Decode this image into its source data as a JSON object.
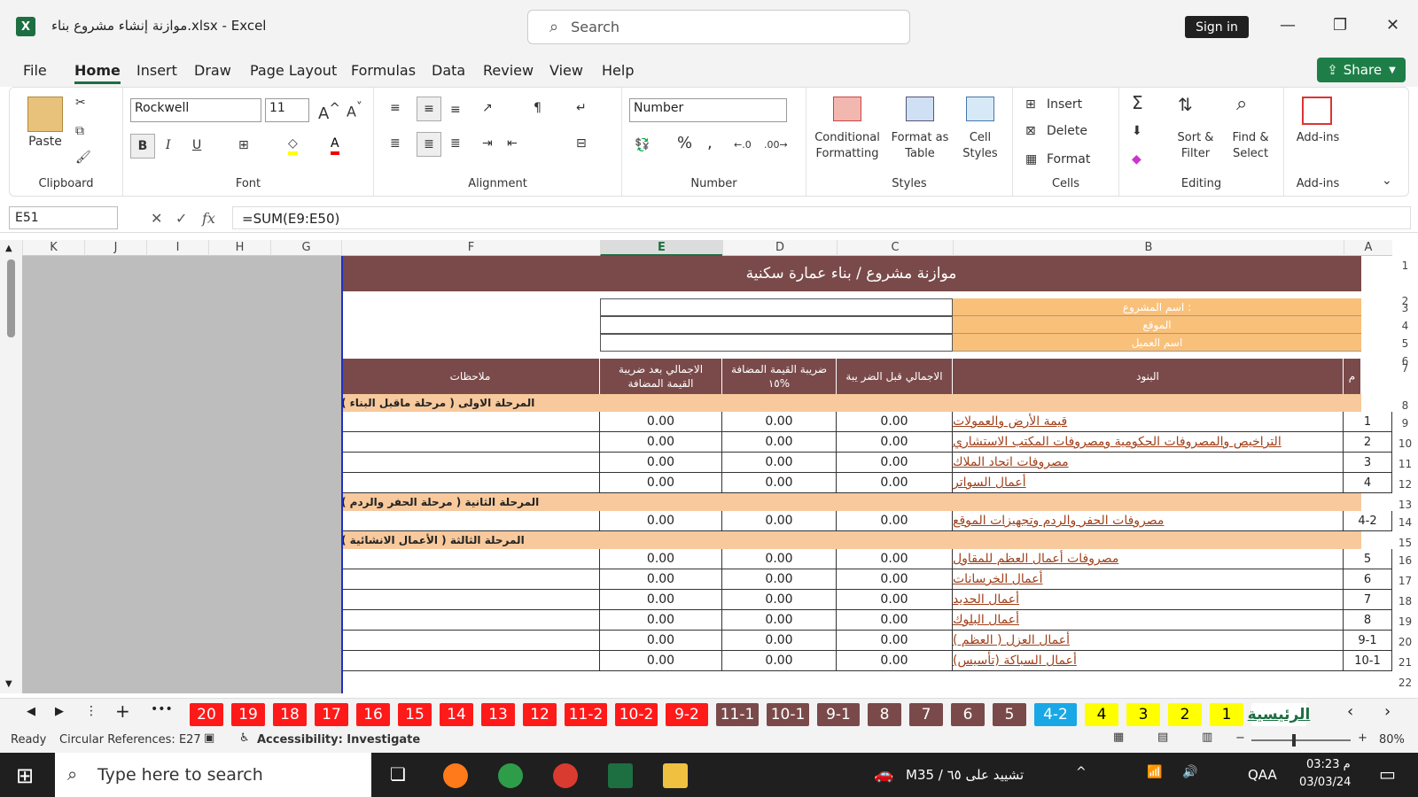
{
  "window": {
    "title": "موازنة إنشاء مشروع بناء.xlsx  -  Excel",
    "search_placeholder": "Search",
    "sign_in": "Sign in"
  },
  "menu": {
    "tabs": [
      "File",
      "Home",
      "Insert",
      "Draw",
      "Page Layout",
      "Formulas",
      "Data",
      "Review",
      "View",
      "Help"
    ],
    "active": "Home",
    "share": "Share"
  },
  "ribbon": {
    "clipboard": {
      "label": "Clipboard",
      "paste": "Paste"
    },
    "font": {
      "label": "Font",
      "family": "Rockwell",
      "size": "11"
    },
    "alignment": {
      "label": "Alignment"
    },
    "number": {
      "label": "Number",
      "format": "Number"
    },
    "styles": {
      "label": "Styles",
      "conditional": "Conditional Formatting",
      "format_table": "Format as Table",
      "cell_styles": "Cell Styles"
    },
    "cells": {
      "label": "Cells",
      "insert": "Insert",
      "delete": "Delete",
      "format": "Format"
    },
    "editing": {
      "label": "Editing",
      "sort": "Sort & Filter",
      "find": "Find & Select"
    },
    "addins": {
      "label": "Add-ins",
      "addins": "Add-ins"
    }
  },
  "formula_bar": {
    "name_box": "E51",
    "formula": "=SUM(E9:E50)"
  },
  "columns": [
    "K",
    "J",
    "I",
    "H",
    "G",
    "F",
    "E",
    "D",
    "C",
    "B",
    "A"
  ],
  "selected_column": "E",
  "row_numbers": [
    "1",
    "2",
    "3",
    "4",
    "5",
    "6",
    "7",
    "8",
    "9",
    "10",
    "11",
    "12",
    "13",
    "14",
    "15",
    "16",
    "17",
    "18",
    "19",
    "20",
    "21",
    "22"
  ],
  "sheet": {
    "title": "موازنة مشروع / بناء عمارة سكنية",
    "info_labels": [
      "اسم المشروع :",
      "الموقع",
      "اسم العميل"
    ],
    "headers": {
      "num": "م",
      "item": "البنود",
      "before_tax": "الاجمالي قبل الضر يبة",
      "vat": "ضريبة القيمة المضافة ١٥%",
      "after_tax": "الاجمالي بعد ضريبة القيمة المضافة",
      "notes": "ملاحظات"
    },
    "rows": [
      {
        "type": "section",
        "label": "المرحلة الاولى ( مرحلة ماقبل البناء )"
      },
      {
        "type": "item",
        "num": "1",
        "item": "قيمة الأرض والعمولات",
        "c": "0.00",
        "d": "0.00",
        "e": "0.00"
      },
      {
        "type": "item",
        "num": "2",
        "item": "التراخيص والمصروفات الحكومية ومصروفات المكتب الاستشاري",
        "c": "0.00",
        "d": "0.00",
        "e": "0.00"
      },
      {
        "type": "item",
        "num": "3",
        "item": "مصروفات اتحاد الملاك",
        "c": "0.00",
        "d": "0.00",
        "e": "0.00"
      },
      {
        "type": "item",
        "num": "4",
        "item": "أعمال السواتر",
        "c": "0.00",
        "d": "0.00",
        "e": "0.00"
      },
      {
        "type": "section",
        "label": "المرحلة الثانية ( مرحلة الحفر والردم )"
      },
      {
        "type": "item",
        "num": "4-2",
        "item": "مصروفات الحفر والردم وتجهيزات الموقع",
        "c": "0.00",
        "d": "0.00",
        "e": "0.00"
      },
      {
        "type": "section",
        "label": "المرحلة الثالثة ( الأعمال الانشائية )"
      },
      {
        "type": "item",
        "num": "5",
        "item": "مصروفات أعمال العظم للمقاول",
        "c": "0.00",
        "d": "0.00",
        "e": "0.00"
      },
      {
        "type": "item",
        "num": "6",
        "item": "أعمال الخرسانات",
        "c": "0.00",
        "d": "0.00",
        "e": "0.00"
      },
      {
        "type": "item",
        "num": "7",
        "item": "أعمال الحديد",
        "c": "0.00",
        "d": "0.00",
        "e": "0.00"
      },
      {
        "type": "item",
        "num": "8",
        "item": "أعمال البلوك",
        "c": "0.00",
        "d": "0.00",
        "e": "0.00"
      },
      {
        "type": "item",
        "num": "9-1",
        "item": "أعمال العزل ( العظم )",
        "c": "0.00",
        "d": "0.00",
        "e": "0.00"
      },
      {
        "type": "item",
        "num": "10-1",
        "item": "أعمال السباكة (تأسيس)",
        "c": "0.00",
        "d": "0.00",
        "e": "0.00"
      }
    ]
  },
  "sheet_tabs": [
    {
      "label": "20",
      "color": "red"
    },
    {
      "label": "19",
      "color": "red"
    },
    {
      "label": "18",
      "color": "red"
    },
    {
      "label": "17",
      "color": "red"
    },
    {
      "label": "16",
      "color": "red"
    },
    {
      "label": "15",
      "color": "red"
    },
    {
      "label": "14",
      "color": "red"
    },
    {
      "label": "13",
      "color": "red"
    },
    {
      "label": "12",
      "color": "red"
    },
    {
      "label": "11-2",
      "color": "red"
    },
    {
      "label": "10-2",
      "color": "red"
    },
    {
      "label": "9-2",
      "color": "red"
    },
    {
      "label": "11-1",
      "color": "brown"
    },
    {
      "label": "10-1",
      "color": "brown"
    },
    {
      "label": "9-1",
      "color": "brown"
    },
    {
      "label": "8",
      "color": "brown"
    },
    {
      "label": "7",
      "color": "brown"
    },
    {
      "label": "6",
      "color": "brown"
    },
    {
      "label": "5",
      "color": "brown"
    },
    {
      "label": "4-2",
      "color": "blue"
    },
    {
      "label": "4",
      "color": "yellow"
    },
    {
      "label": "3",
      "color": "yellow"
    },
    {
      "label": "2",
      "color": "yellow"
    },
    {
      "label": "1",
      "color": "yellow"
    },
    {
      "label": "الرئيسية",
      "color": "active"
    }
  ],
  "status": {
    "ready": "Ready",
    "circular": "Circular References: E27",
    "accessibility": "Accessibility: Investigate",
    "zoom": "80%"
  },
  "taskbar": {
    "search": "Type here to search",
    "notification": "M35 / تشييد على ٦٥",
    "lang": "QAA",
    "time": "03:23 م",
    "date": "03/03/24"
  },
  "colors": {
    "header_bg": "#7a4a4a",
    "section_bg": "#f7c99d",
    "info_bg": "#f9c07a",
    "red_tab": "#ff1a1a",
    "brown_tab": "#7a4a4a",
    "blue_tab": "#1aa7e6",
    "yellow_tab": "#ffff00",
    "accent": "#1d6f42"
  }
}
